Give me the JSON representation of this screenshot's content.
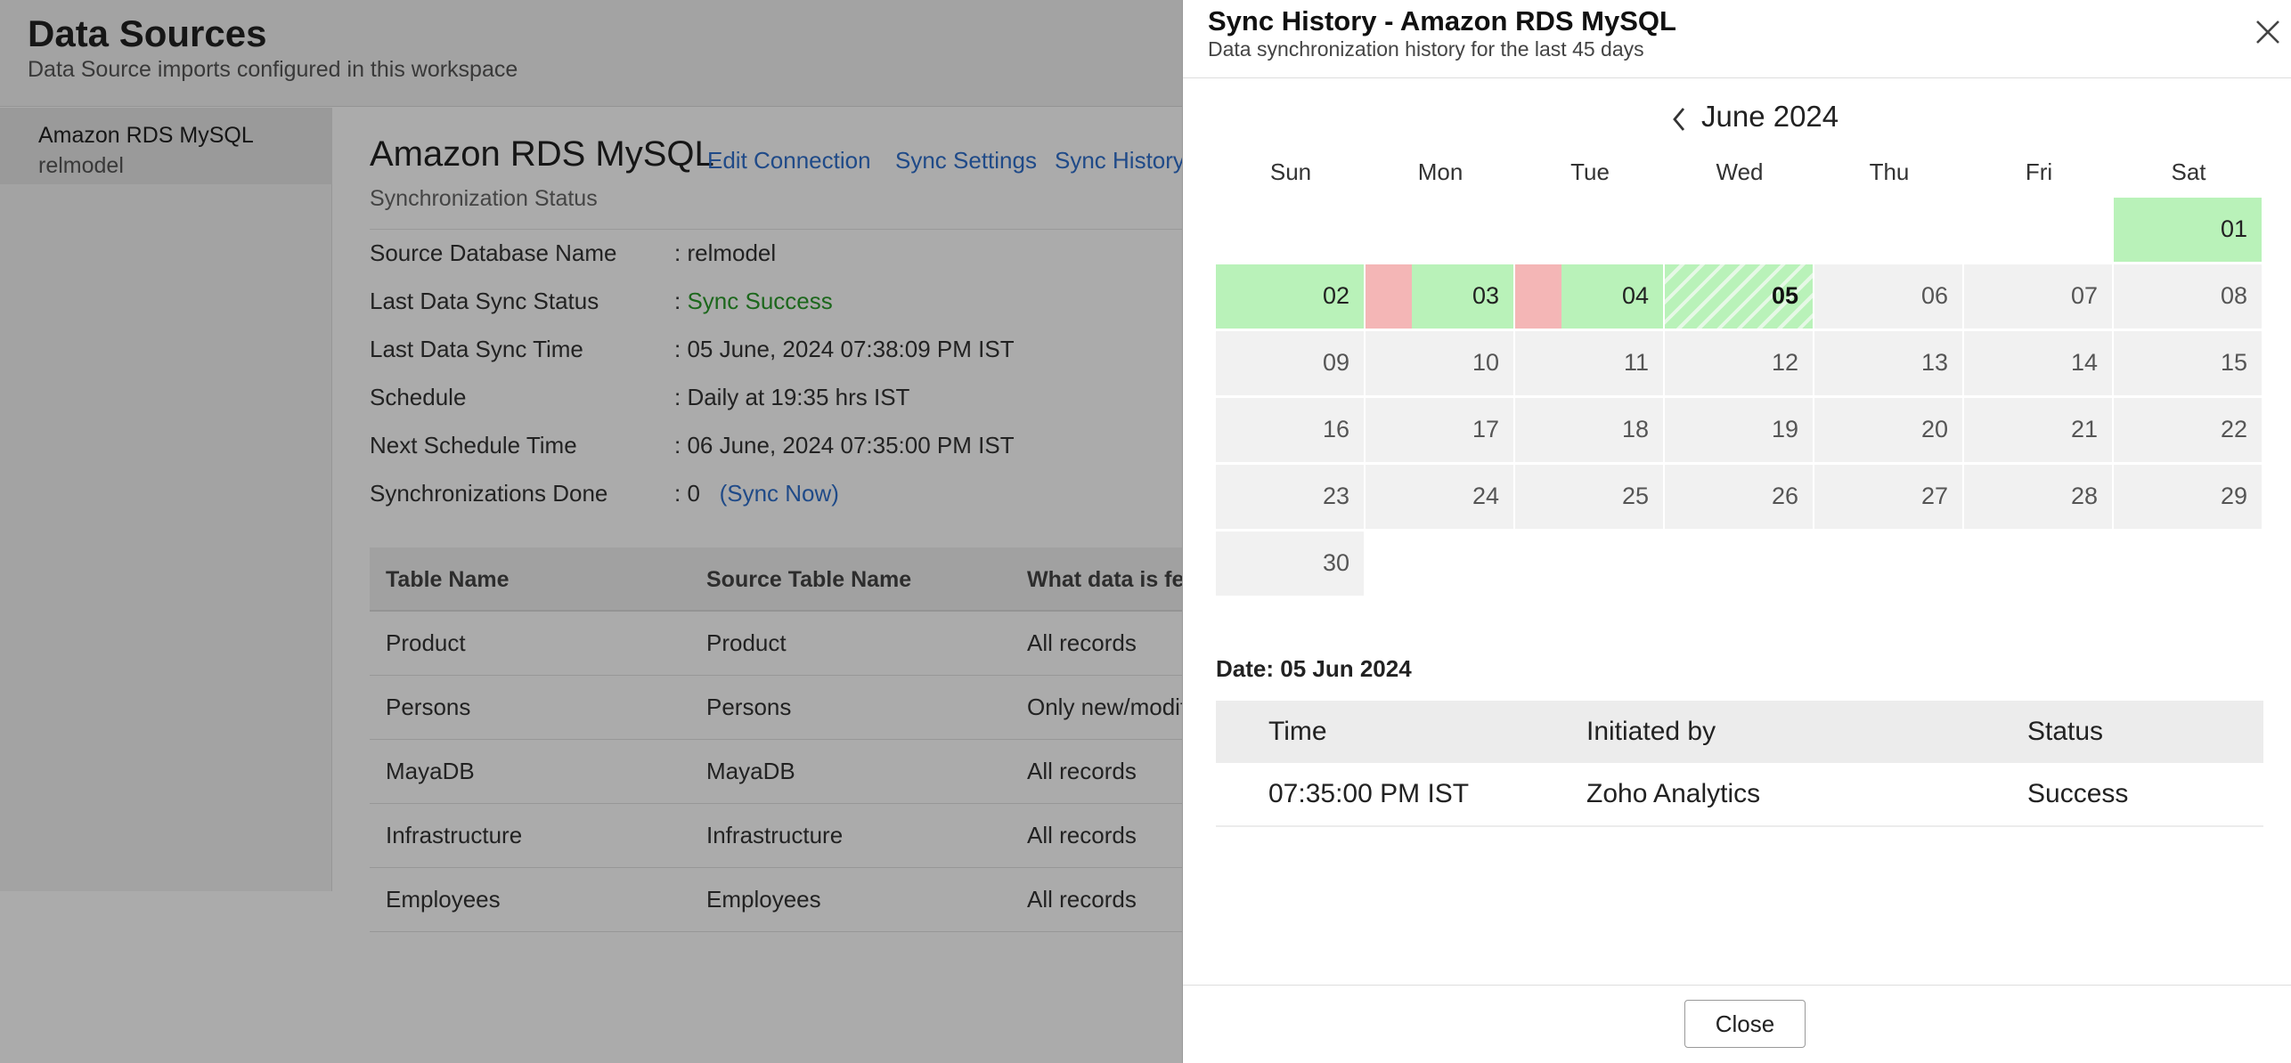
{
  "page": {
    "title": "Data Sources",
    "subtitle": "Data Source imports configured in this workspace"
  },
  "sidebar": {
    "items": [
      {
        "name": "Amazon RDS MySQL",
        "sub": "relmodel"
      }
    ]
  },
  "source": {
    "title": "Amazon RDS MySQL",
    "links": {
      "edit": "Edit Connection",
      "settings": "Sync Settings",
      "history": "Sync History"
    },
    "status_heading": "Synchronization Status",
    "info": {
      "db_label": "Source Database Name",
      "db_value": ": relmodel",
      "status_label": "Last Data Sync Status",
      "status_prefix": ":",
      "status_value": "Sync Success",
      "time_label": "Last Data Sync Time",
      "time_value": ": 05 June, 2024 07:38:09 PM IST",
      "schedule_label": "Schedule",
      "schedule_value": ": Daily at 19:35 hrs IST",
      "next_label": "Next Schedule Time",
      "next_value": ": 06 June, 2024 07:35:00 PM IST",
      "done_label": "Synchronizations Done",
      "done_value": ": 0",
      "sync_now": "(Sync Now)"
    },
    "table": {
      "headers": [
        "Table Name",
        "Source Table Name",
        "What data is fet"
      ],
      "rows": [
        [
          "Product",
          "Product",
          "All records"
        ],
        [
          "Persons",
          "Persons",
          "Only new/modif"
        ],
        [
          "MayaDB",
          "MayaDB",
          "All records"
        ],
        [
          "Infrastructure",
          "Infrastructure",
          "All records"
        ],
        [
          "Employees",
          "Employees",
          "All records"
        ]
      ]
    }
  },
  "panel": {
    "title": "Sync History - Amazon RDS MySQL",
    "subtitle": "Data synchronization history for the last 45 days",
    "close_icon": "close-icon",
    "prev_icon": "chevron-left-icon",
    "month": "June 2024",
    "weekdays": [
      "Sun",
      "Mon",
      "Tue",
      "Wed",
      "Thu",
      "Fri",
      "Sat"
    ],
    "first_weekday_index": 6,
    "days": [
      "01",
      "02",
      "03",
      "04",
      "05",
      "06",
      "07",
      "08",
      "09",
      "10",
      "11",
      "12",
      "13",
      "14",
      "15",
      "16",
      "17",
      "18",
      "19",
      "20",
      "21",
      "22",
      "23",
      "24",
      "25",
      "26",
      "27",
      "28",
      "29",
      "30"
    ],
    "success_days": [
      "01",
      "02",
      "03",
      "04"
    ],
    "failure_days": [
      "03",
      "04"
    ],
    "selected_day": "05",
    "colors": {
      "success": "#b9f2b9",
      "failure": "#f4b6b6",
      "empty": "#f1f1f1",
      "status_success": "#2a9a2a",
      "link": "#2f6fcb"
    },
    "detail": {
      "date": "Date: 05 Jun 2024",
      "headers": [
        "Time",
        "Initiated by",
        "Status"
      ],
      "rows": [
        [
          "07:35:00 PM IST",
          "Zoho Analytics",
          "Success"
        ]
      ]
    },
    "close_label": "Close"
  }
}
